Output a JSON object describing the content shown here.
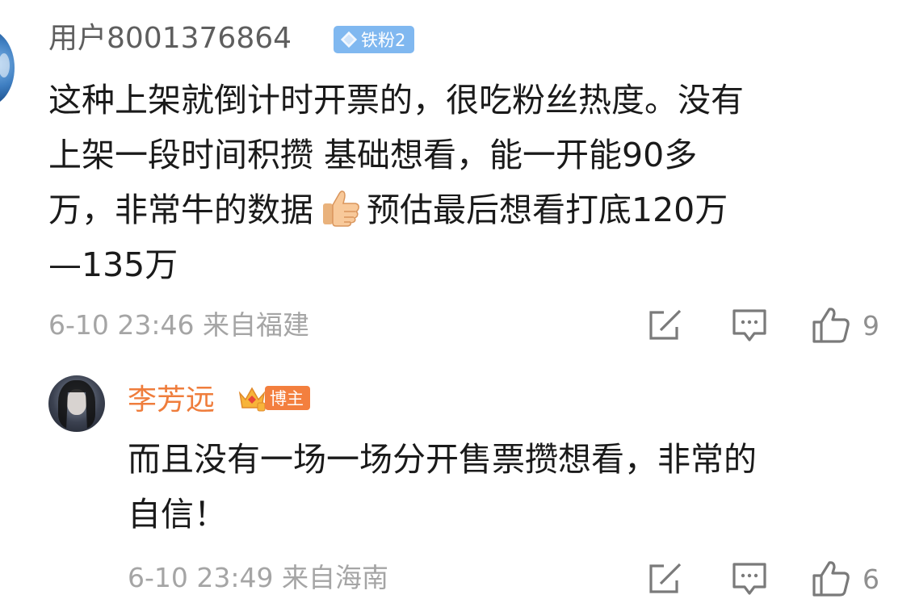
{
  "comments": [
    {
      "username": "用户8001376864",
      "badge": {
        "icon": "diamond-icon",
        "label": "铁粉2",
        "color": "#80b8f0"
      },
      "content_lines": [
        "这种上架就倒计时开票的，很吃粉丝热度。没有",
        "上架一段时间积攒 基础想看，能一开能90多",
        "万，非常牛的数据",
        "预估最后想看打底120万",
        "—135万"
      ],
      "emoji": "thumbs-up-icon",
      "meta": "6-10 23:46 来自福建",
      "likes": "9"
    },
    {
      "username": "李芳远",
      "badge": {
        "icon": "crown-icon",
        "label": "博主",
        "color": "#f37f3e"
      },
      "content_lines": [
        "而且没有一场一场分开售票攒想看，非常的",
        "自信！"
      ],
      "meta": "6-10 23:49 来自海南",
      "likes": "6"
    }
  ],
  "icons": {
    "share": "share-icon",
    "comment": "comment-icon",
    "like": "like-icon"
  },
  "colors": {
    "username_default": "#5e5e5e",
    "username_author": "#ef7d3c",
    "meta": "#a5a5a5",
    "text": "#1a1a1a"
  }
}
